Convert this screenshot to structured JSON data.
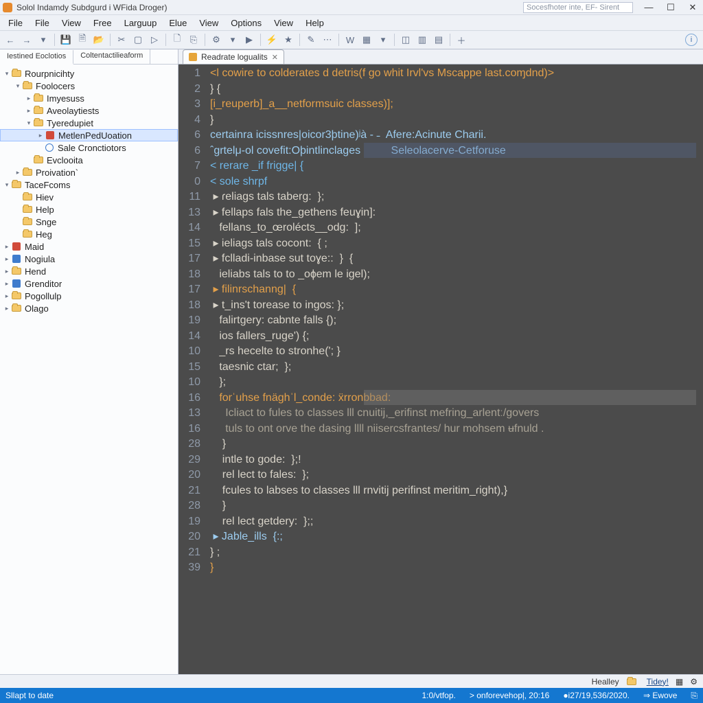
{
  "title": "Solol Indamdy Subdgurd i WFida Droger)",
  "search_placeholder": "Socesfhoter inte, EF- Sirent",
  "window_buttons": {
    "min": "—",
    "max": "☐",
    "close": "✕"
  },
  "menu": [
    "File",
    "File",
    "View",
    "Free",
    "Larguup",
    "Elue",
    "View",
    "Options",
    "View",
    "Help"
  ],
  "toolbar_icons": [
    "arrow-left",
    "arrow-right",
    "arrow-down",
    "sep",
    "save",
    "save-all",
    "folder-open",
    "sep",
    "scissors",
    "box",
    "play-alt",
    "sep",
    "doc",
    "tab",
    "sep",
    "gear-blue",
    "arrow-down",
    "play",
    "sep",
    "bolt",
    "star",
    "sep",
    "wand",
    "dots",
    "sep",
    "word",
    "grid",
    "arrow-down",
    "sep",
    "panel",
    "panel2",
    "panel3",
    "sep",
    "plus"
  ],
  "sidebar_tabs": [
    "Iestined Eoclotios",
    "Coltentactilieaform"
  ],
  "tree": [
    {
      "d": 0,
      "t": "▾",
      "i": "folder",
      "l": "Rourpnicihty"
    },
    {
      "d": 1,
      "t": "▾",
      "i": "folder",
      "l": "Foolocers"
    },
    {
      "d": 2,
      "t": "▸",
      "i": "folder",
      "l": "Imyesuss"
    },
    {
      "d": 2,
      "t": "▸",
      "i": "folder",
      "l": "Aveolaytiests"
    },
    {
      "d": 2,
      "t": "▾",
      "i": "folder",
      "l": "Tyeredupiet"
    },
    {
      "d": 3,
      "t": "▸",
      "i": "red",
      "l": "MetlenPedUoation",
      "sel": true
    },
    {
      "d": 3,
      "t": "",
      "i": "globe",
      "l": "Sale Cronctiotors"
    },
    {
      "d": 2,
      "t": "",
      "i": "folder",
      "l": "Evclooita"
    },
    {
      "d": 1,
      "t": "▸",
      "i": "folder",
      "l": "Proivation`"
    },
    {
      "d": 0,
      "t": "▾",
      "i": "folder",
      "l": "TaceFcoms"
    },
    {
      "d": 1,
      "t": "",
      "i": "folder",
      "l": "Hiev"
    },
    {
      "d": 1,
      "t": "",
      "i": "folder",
      "l": "Help"
    },
    {
      "d": 1,
      "t": "",
      "i": "folder",
      "l": "Snge"
    },
    {
      "d": 1,
      "t": "",
      "i": "folder",
      "l": "Heg"
    },
    {
      "d": 0,
      "t": "▸",
      "i": "red",
      "l": "Maid"
    },
    {
      "d": 0,
      "t": "▸",
      "i": "blue",
      "l": "Nogiula"
    },
    {
      "d": 0,
      "t": "▸",
      "i": "folder",
      "l": "Hend"
    },
    {
      "d": 0,
      "t": "▸",
      "i": "blue",
      "l": "Grenditor"
    },
    {
      "d": 0,
      "t": "▸",
      "i": "folder",
      "l": "Pogollulp"
    },
    {
      "d": 0,
      "t": "▸",
      "i": "folder",
      "l": "Olago"
    }
  ],
  "editor_tab": {
    "label": "Readrate logualits",
    "close": "✕"
  },
  "gutter": [
    "1",
    "2",
    "3",
    "4",
    "6",
    "6",
    "7",
    "0",
    "11",
    "13",
    "14",
    "15",
    "17",
    "18",
    "17",
    "18",
    "19",
    "14",
    "10",
    "15",
    "10",
    "16",
    "13",
    "16",
    "28",
    "29",
    "20",
    "21",
    "28",
    "19",
    "20",
    "21",
    "39"
  ],
  "code": [
    {
      "c": "orange",
      "x": "<l cowire to colderates d detris(f go whit Irvl'vs Mscappe last.coɱdnd)>"
    },
    {
      "c": "",
      "x": "} {"
    },
    {
      "c": "orange",
      "x": "[i_reuperb]_a__netformsuic classes)];"
    },
    {
      "c": "",
      "x": "}"
    },
    {
      "c": "lblue",
      "x": "certainra icissnres|oicor3þtine)ʲà - ˗  Afere:Acinute Charii."
    },
    {
      "c": "lblue",
      "x": "ˆgrtelμ-ol covefit:Oþintlinclages          Seleolacerve-Cetforuse"
    },
    {
      "c": "blue",
      "x": "< rerare _if frigge| {"
    },
    {
      "c": "blue",
      "x": "< sole shrpf"
    },
    {
      "c": "",
      "x": " ▸ ɾeliags tals taberg:  };"
    },
    {
      "c": "",
      "x": " ▸ fellaps fals the_gethens feuɣin]:"
    },
    {
      "c": "",
      "x": "   fellans_to_œrolécts__odg:  ];"
    },
    {
      "c": "",
      "x": " ▸ ieliags tals cocont:  { ;"
    },
    {
      "c": "",
      "x": " ▸ fclladi-inbase sut toɣe::  }  {"
    },
    {
      "c": "",
      "x": "   ieliabs tals to to _oɸem le igel);"
    },
    {
      "c": "orange",
      "x": " ▸ filinrschanng|  {"
    },
    {
      "c": "",
      "x": " ▸ t_ins't torease to ingos: };"
    },
    {
      "c": "",
      "x": "   falirtgery: cabnte falls {);"
    },
    {
      "c": "",
      "x": "   ios fallers_ruge') {;"
    },
    {
      "c": "",
      "x": "   _rs hecelte to stronhe('; }"
    },
    {
      "c": "",
      "x": "   taesnic ctar;  };"
    },
    {
      "c": "",
      "x": "   };"
    },
    {
      "c": "orange",
      "x": "   forˈuhse fnäɡhˈl_conde: ẍrronbbad:"
    },
    {
      "c": "dim",
      "x": "     Icliact to fules to classes lll cnuitij,_erifinst mefring_arlentː/govers"
    },
    {
      "c": "dim",
      "x": "     tuls to ont orve the dasing llll niisercsfrantes/ hur mohsem ʉfnuld ."
    },
    {
      "c": "",
      "x": "    }"
    },
    {
      "c": "",
      "x": "    intle to gode:  };!"
    },
    {
      "c": "",
      "x": "    rel lect to fales:  };"
    },
    {
      "c": "",
      "x": "    fcules to labses to classes lll rnvitij perifinst meritim_ɾight),}"
    },
    {
      "c": "",
      "x": "    }"
    },
    {
      "c": "",
      "x": "    rel lect getdery:  };;"
    },
    {
      "c": "lblue",
      "x": " ▸ Jable_ills  {:;"
    },
    {
      "c": "",
      "x": "} ;"
    },
    {
      "c": "orange",
      "x": "}"
    }
  ],
  "footer1": {
    "label": "Healley",
    "link": "Tidey!"
  },
  "status": {
    "left": "Sllapt to date",
    "a": "1:0/vtfop.",
    "b": "> onforevehopļ,  20:16",
    "c": "●i27/19,536/2020.",
    "d": "⇒ Ewove",
    "e": "⎘"
  }
}
